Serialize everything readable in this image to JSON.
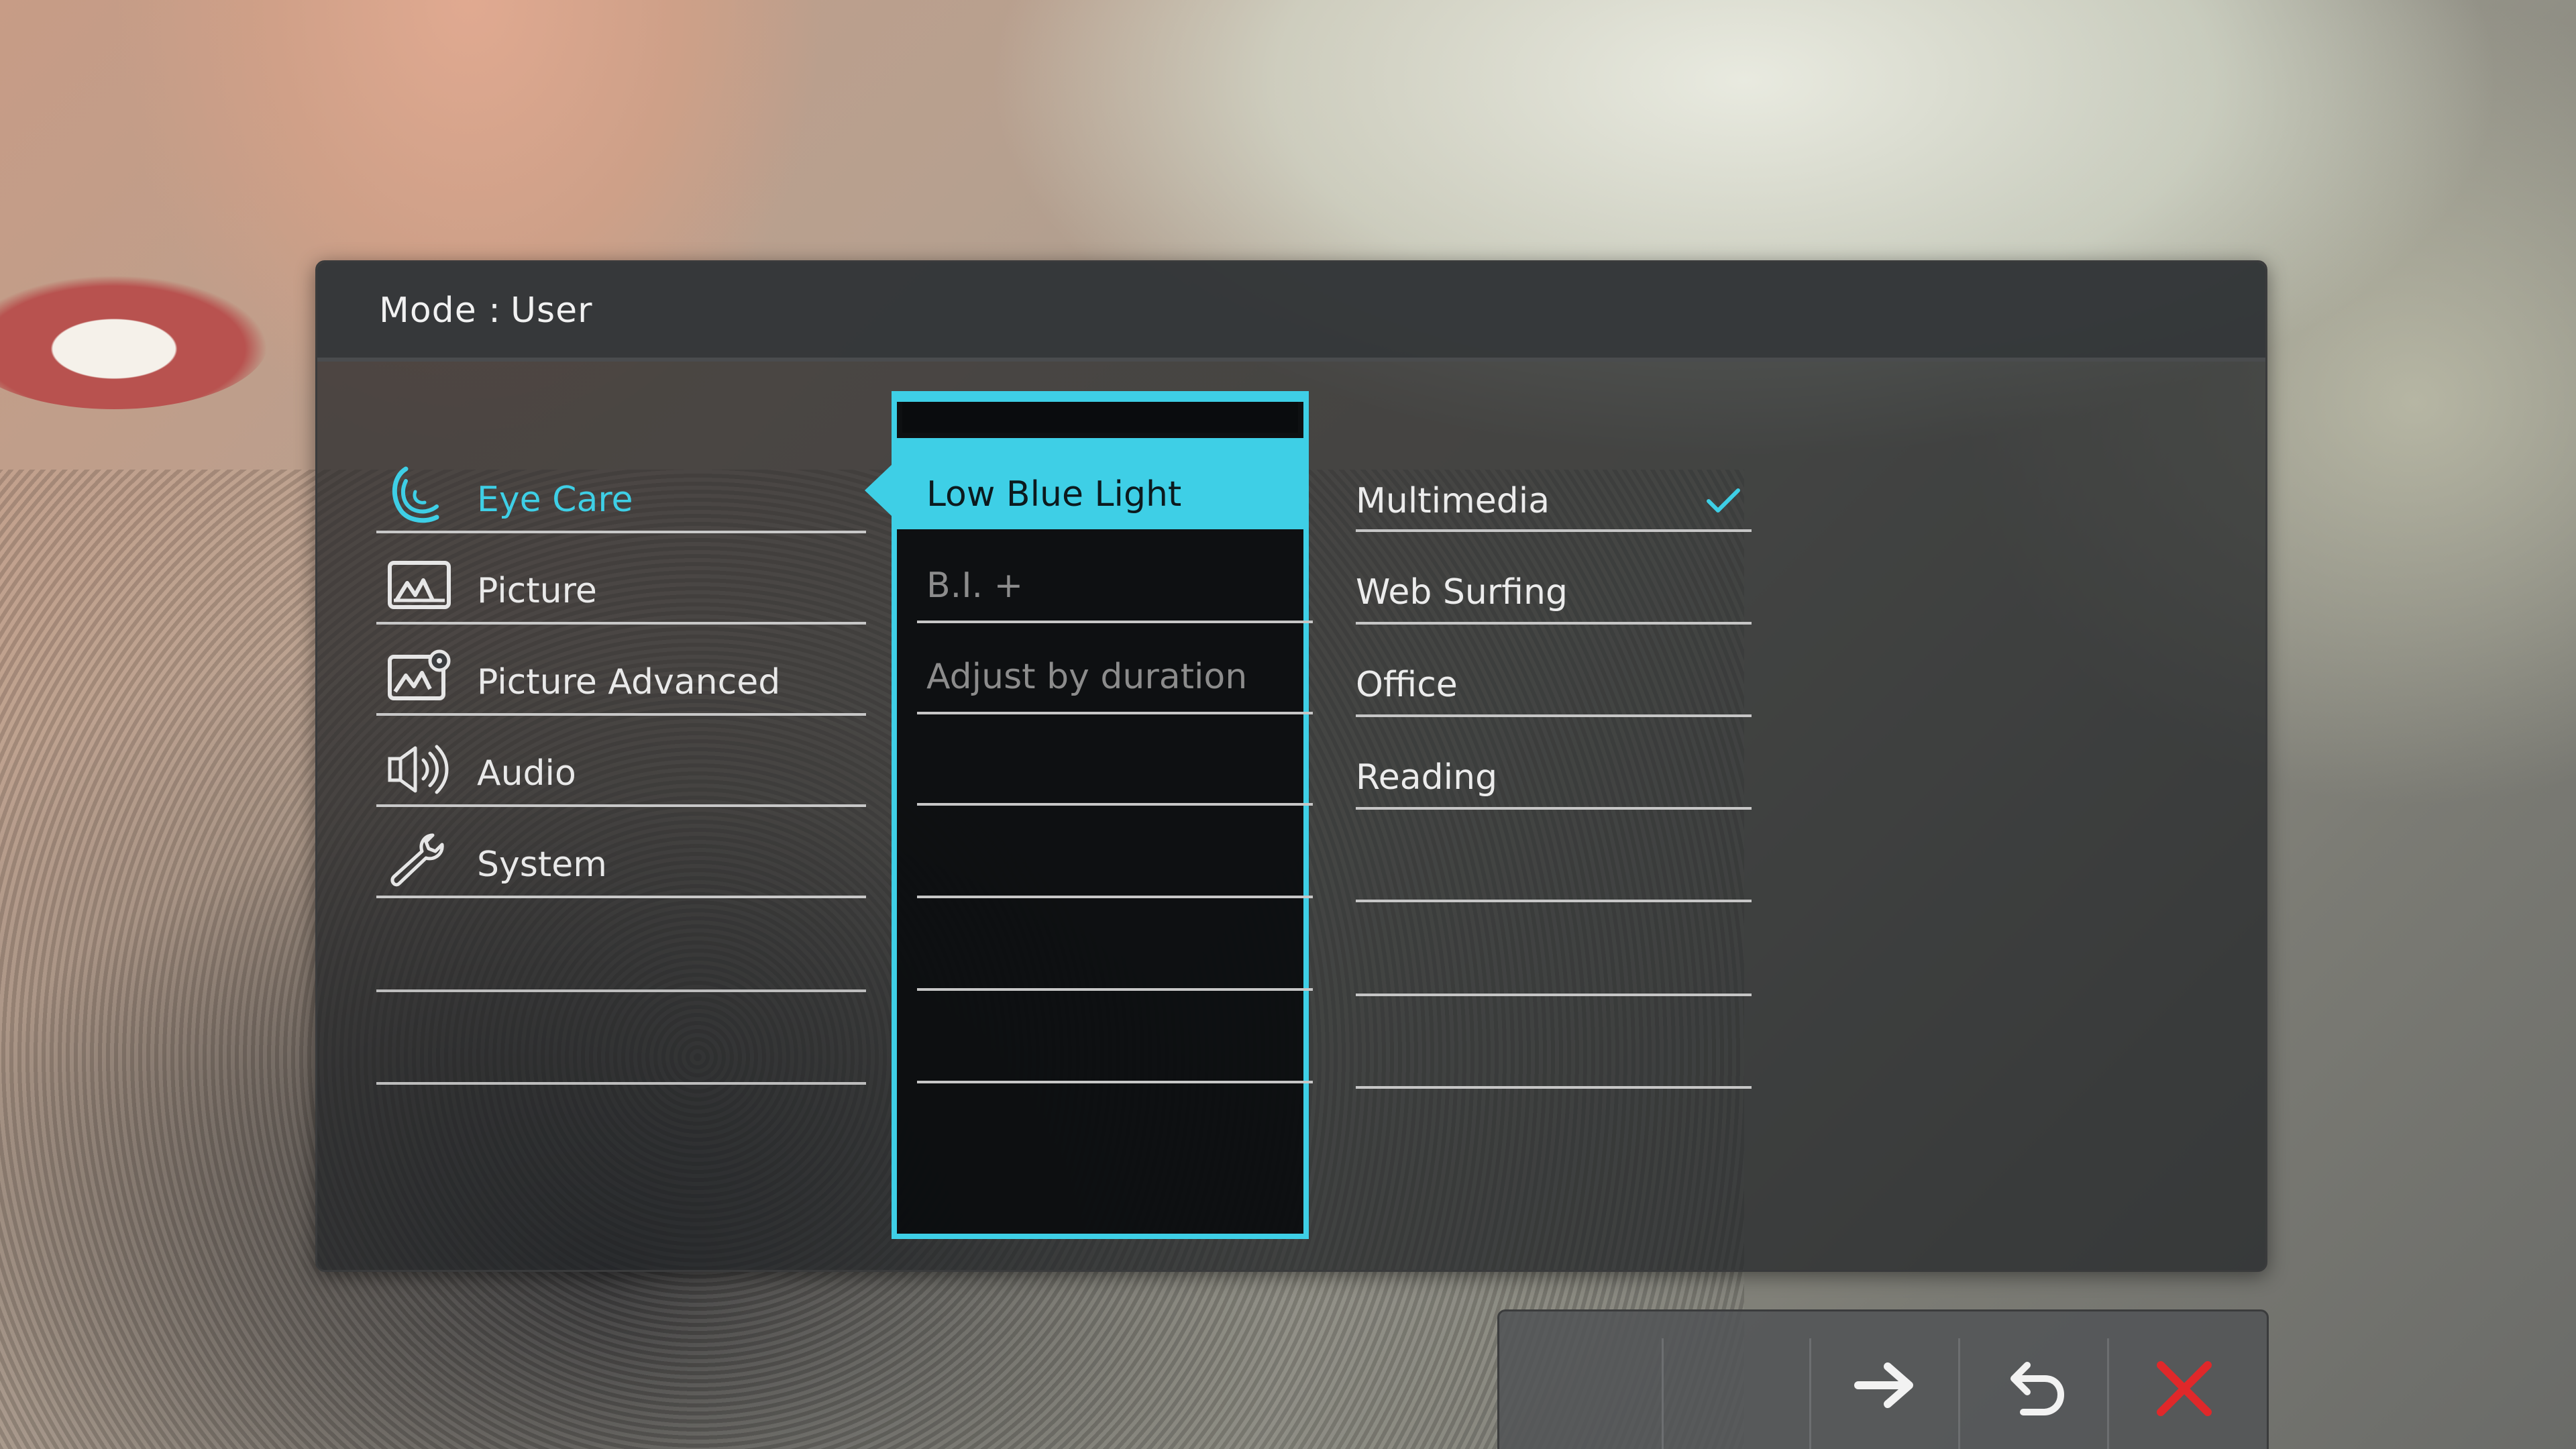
{
  "header": {
    "mode_label": "Mode :",
    "mode_value": "User"
  },
  "menu": {
    "items": [
      {
        "label": "Eye Care",
        "icon": "eye-care-icon",
        "active": true
      },
      {
        "label": "Picture",
        "icon": "picture-icon",
        "active": false
      },
      {
        "label": "Picture Advanced",
        "icon": "picture-advanced-icon",
        "active": false
      },
      {
        "label": "Audio",
        "icon": "speaker-icon",
        "active": false
      },
      {
        "label": "System",
        "icon": "wrench-icon",
        "active": false
      }
    ]
  },
  "submenu": {
    "items": [
      {
        "label": "Low Blue Light",
        "state": "selected"
      },
      {
        "label": "B.I. +",
        "state": "disabled"
      },
      {
        "label": "Adjust by duration",
        "state": "disabled"
      }
    ]
  },
  "options": {
    "items": [
      {
        "label": "Multimedia",
        "checked": true
      },
      {
        "label": "Web Surfing",
        "checked": false
      },
      {
        "label": "Office",
        "checked": false
      },
      {
        "label": "Reading",
        "checked": false
      }
    ]
  },
  "keyguide": {
    "keys": [
      "arrow-right-icon",
      "return-icon",
      "close-icon"
    ]
  },
  "colors": {
    "accent": "#3ecfe6",
    "close": "#e0282a",
    "panel": "#202326"
  }
}
